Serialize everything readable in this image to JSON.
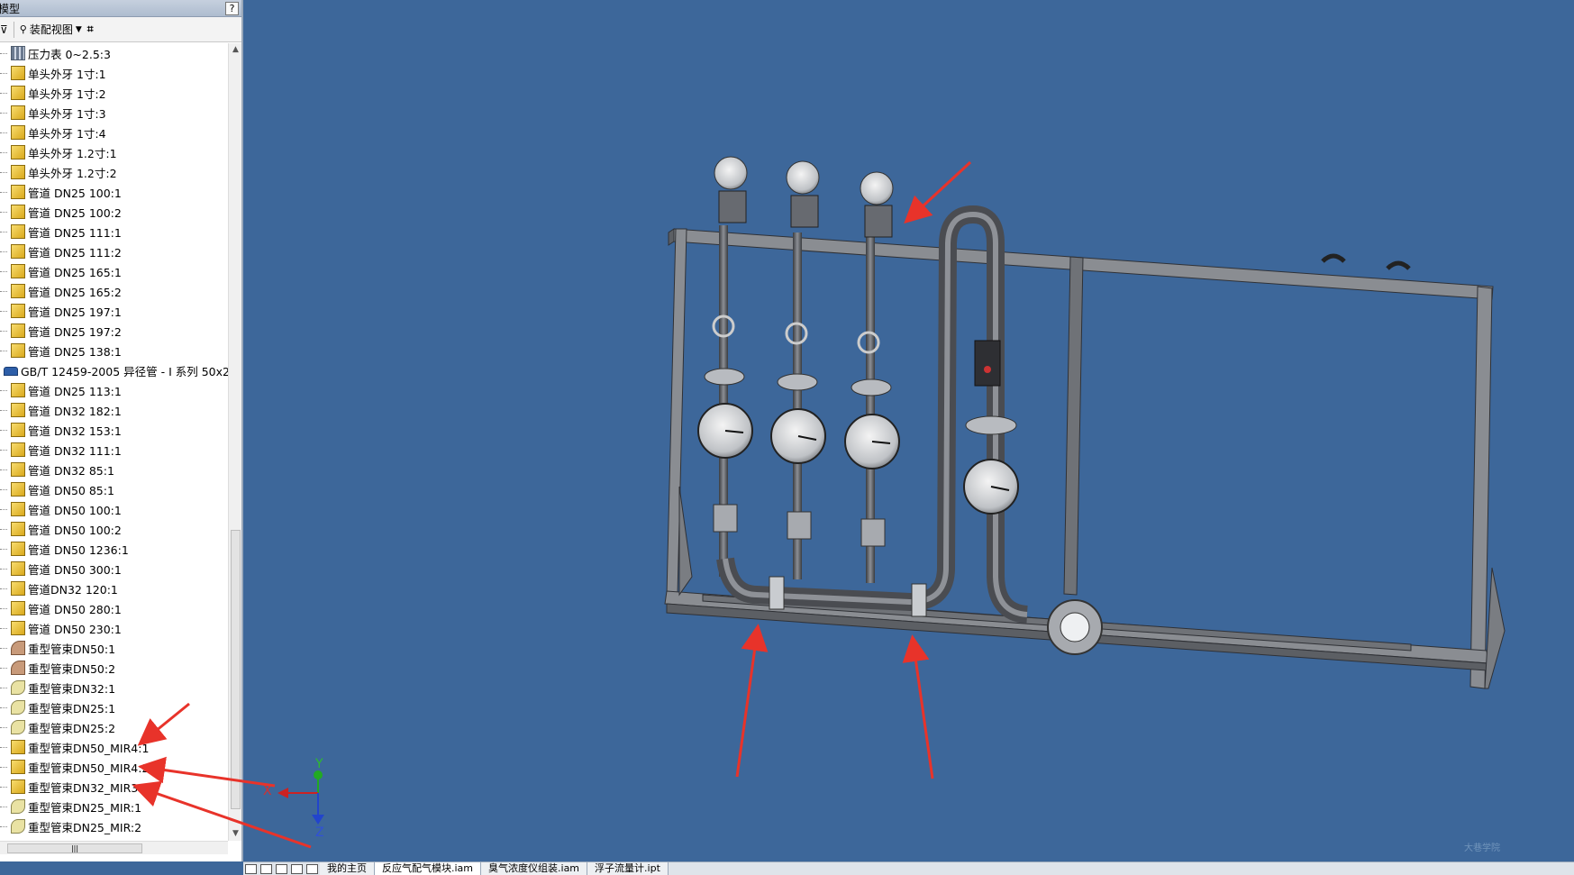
{
  "panel": {
    "title": "模型",
    "toolbar_view_label": "装配视图",
    "help_label": "?"
  },
  "tree_items": [
    {
      "label": "压力表 0~2.5:3",
      "icon": "assembly-icon"
    },
    {
      "label": "单头外牙  1寸:1",
      "icon": "part-icon"
    },
    {
      "label": "单头外牙  1寸:2",
      "icon": "part-icon"
    },
    {
      "label": "单头外牙  1寸:3",
      "icon": "part-icon"
    },
    {
      "label": "单头外牙  1寸:4",
      "icon": "part-icon"
    },
    {
      "label": "单头外牙  1.2寸:1",
      "icon": "part-icon"
    },
    {
      "label": "单头外牙  1.2寸:2",
      "icon": "part-icon"
    },
    {
      "label": "管道 DN25 100:1",
      "icon": "part-icon"
    },
    {
      "label": "管道 DN25 100:2",
      "icon": "part-icon"
    },
    {
      "label": "管道 DN25 111:1",
      "icon": "part-icon"
    },
    {
      "label": "管道 DN25 111:2",
      "icon": "part-icon"
    },
    {
      "label": "管道 DN25 165:1",
      "icon": "part-icon"
    },
    {
      "label": "管道 DN25 165:2",
      "icon": "part-icon"
    },
    {
      "label": "管道 DN25 197:1",
      "icon": "part-icon"
    },
    {
      "label": "管道 DN25 197:2",
      "icon": "part-icon"
    },
    {
      "label": "管道 DN25 138:1",
      "icon": "part-icon"
    },
    {
      "label": "GB/T 12459-2005 异径管 - I 系列 50x2",
      "icon": "standard-part-icon"
    },
    {
      "label": "管道 DN25 113:1",
      "icon": "part-icon"
    },
    {
      "label": "管道 DN32 182:1",
      "icon": "part-icon"
    },
    {
      "label": "管道 DN32 153:1",
      "icon": "part-icon"
    },
    {
      "label": "管道 DN32 111:1",
      "icon": "part-icon"
    },
    {
      "label": "管道 DN32 85:1",
      "icon": "part-icon"
    },
    {
      "label": "管道 DN50 85:1",
      "icon": "part-icon"
    },
    {
      "label": "管道 DN50 100:1",
      "icon": "part-icon"
    },
    {
      "label": "管道 DN50 100:2",
      "icon": "part-icon"
    },
    {
      "label": "管道 DN50 1236:1",
      "icon": "part-icon"
    },
    {
      "label": "管道 DN50 300:1",
      "icon": "part-icon"
    },
    {
      "label": "管道DN32 120:1",
      "icon": "part-icon"
    },
    {
      "label": "管道 DN50 280:1",
      "icon": "part-icon"
    },
    {
      "label": "管道 DN50 230:1",
      "icon": "part-icon"
    },
    {
      "label": "重型管束DN50:1",
      "icon": "elbow-icon"
    },
    {
      "label": "重型管束DN50:2",
      "icon": "elbow-icon"
    },
    {
      "label": "重型管束DN32:1",
      "icon": "clamp-icon"
    },
    {
      "label": "重型管束DN25:1",
      "icon": "clamp-icon"
    },
    {
      "label": "重型管束DN25:2",
      "icon": "clamp-icon"
    },
    {
      "label": "重型管束DN50_MIR4:1",
      "icon": "part-icon"
    },
    {
      "label": "重型管束DN50_MIR4:2",
      "icon": "part-icon"
    },
    {
      "label": "重型管束DN32_MIR3:1",
      "icon": "part-icon"
    },
    {
      "label": "重型管束DN25_MIR:1",
      "icon": "clamp-icon"
    },
    {
      "label": "重型管束DN25_MIR:2",
      "icon": "clamp-icon"
    }
  ],
  "axis_triad": {
    "x": "X",
    "y": "Y",
    "z": "Z"
  },
  "tabs": [
    {
      "label": "我的主页",
      "active": false
    },
    {
      "label": "反应气配气模块.iam",
      "active": true
    },
    {
      "label": "臭气浓度仪组装.iam",
      "active": false
    },
    {
      "label": "浮子流量计.ipt",
      "active": false
    }
  ],
  "watermark": "大巷学院",
  "colors": {
    "viewport_bg": "#3d679a",
    "annotation_arrow": "#e8332a",
    "frame_gray": "#8a8d92"
  }
}
